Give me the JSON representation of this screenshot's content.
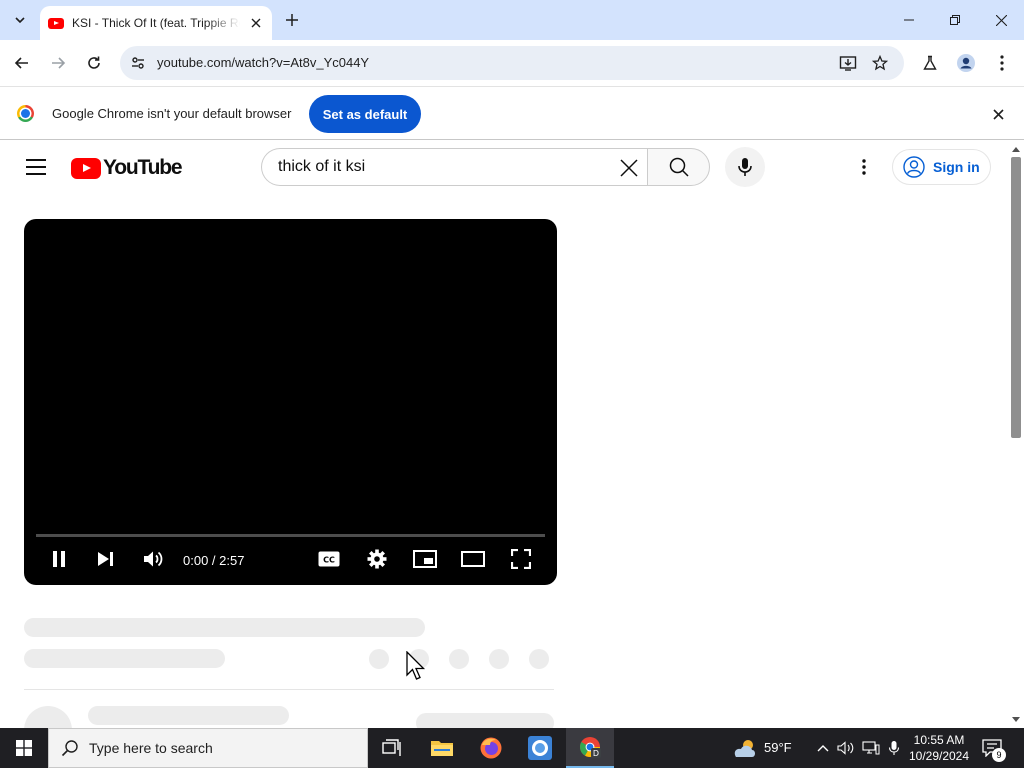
{
  "browser": {
    "tab": {
      "title": "KSI - Thick Of It (feat. Trippie Redd) - YouTube"
    },
    "url": "youtube.com/watch?v=At8v_Yc044Y",
    "infobar": {
      "message": "Google Chrome isn't your default browser",
      "button_label": "Set as default"
    }
  },
  "youtube": {
    "logo_text": "YouTube",
    "search": {
      "value": "thick of it ksi",
      "placeholder": "Search"
    },
    "sign_in_label": "Sign in",
    "player": {
      "time": "0:00 / 2:57",
      "progress": 0
    }
  },
  "taskbar": {
    "search_placeholder": "Type here to search",
    "weather": "59°F",
    "time": "10:55 AM",
    "date": "10/29/2024",
    "notification_count": "9"
  },
  "colors": {
    "youtube_red": "#ff0000",
    "chrome_blue": "#0b57d0",
    "link_blue": "#065fd4",
    "tab_strip": "#d3e3fd"
  }
}
